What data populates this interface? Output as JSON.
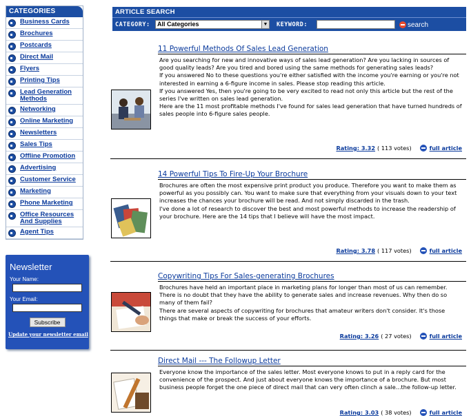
{
  "sidebar": {
    "title": "CATEGORIES",
    "items": [
      {
        "label": "Business Cards"
      },
      {
        "label": "Brochures"
      },
      {
        "label": "Postcards"
      },
      {
        "label": "Direct Mail"
      },
      {
        "label": "Flyers"
      },
      {
        "label": "Printing Tips"
      },
      {
        "label": "Lead Generation Methods"
      },
      {
        "label": "Networking"
      },
      {
        "label": "Online Marketing"
      },
      {
        "label": "Newsletters"
      },
      {
        "label": "Sales Tips"
      },
      {
        "label": "Offline Promotion"
      },
      {
        "label": "Advertising"
      },
      {
        "label": "Customer Service"
      },
      {
        "label": "Marketing"
      },
      {
        "label": "Phone Marketing"
      },
      {
        "label": "Office Resources And Supplies"
      },
      {
        "label": "Agent Tips"
      }
    ]
  },
  "newsletter": {
    "title": "Newsletter",
    "name_label": "Your Name:",
    "email_label": "Your Email:",
    "subscribe_label": "Subscribe",
    "update_link": "Update your newsletter email"
  },
  "search": {
    "title": "ARTICLE SEARCH",
    "category_label": "CATEGORY:",
    "category_value": "All Categories",
    "keyword_label": "KEYWORD:",
    "keyword_value": "",
    "go_label": "search"
  },
  "articles": [
    {
      "title": "11 Powerful Methods Of Sales Lead Generation",
      "summary": [
        "Are you searching for new and innovative ways of sales lead generation? Are you lacking in sources of good quality leads? Are you tired and bored using the same methods for generating sales leads?",
        "If you answered No to these questions you're either satisfied with the income you're earning or you're not interested in earning a 6-figure income in sales. Please stop reading this article.",
        "If you answered Yes, then you're going to be very excited to read not only this article but the rest of the series I've written on sales lead generation.",
        "Here are the 11 most profitable methods I've found for sales lead generation that have turned hundreds of sales people into 6-figure sales people."
      ],
      "rating": "Rating: 3.32",
      "votes": "( 113 votes)",
      "full_label": "full article"
    },
    {
      "title": "14 Powerful Tips To Fire-Up Your Brochure",
      "summary": [
        "Brochures are often the most expensive print product you produce. Therefore you want to make them as powerful as you possibly can. You want to make sure that everything from your visuals down to your text increases the chances your brochure will be read. And not simply discarded in the trash.",
        "I've done a lot of research to discover the best and most powerful methods to increase the readership of your brochure. Here are the 14 tips that I believe will have the most impact."
      ],
      "rating": "Rating: 3.78",
      "votes": "( 117 votes)",
      "full_label": "full article"
    },
    {
      "title": "Copywriting Tips For Sales-generating Brochures",
      "summary": [
        "Brochures have held an important place in marketing plans for longer than most of us can remember. There is no doubt that they have the ability to generate sales and increase revenues. Why then do so many of them fail?",
        "There are several aspects of copywriting for brochures that amateur writers don't consider. It's those things that make or break the success of your efforts."
      ],
      "rating": "Rating: 3.26",
      "votes": "( 27 votes)",
      "full_label": "full article"
    },
    {
      "title": "Direct Mail --- The Followup Letter",
      "summary": [
        "Everyone know the importance of the sales letter. Most everyone knows to put in a reply card for the convenience of the prospect. And just about everyone knows the importance of a brochure. But most business people forget the one piece of direct mail that can very often clinch a sale...the follow-up letter."
      ],
      "rating": "Rating: 3.03",
      "votes": "( 38 votes)",
      "full_label": "full article"
    }
  ]
}
